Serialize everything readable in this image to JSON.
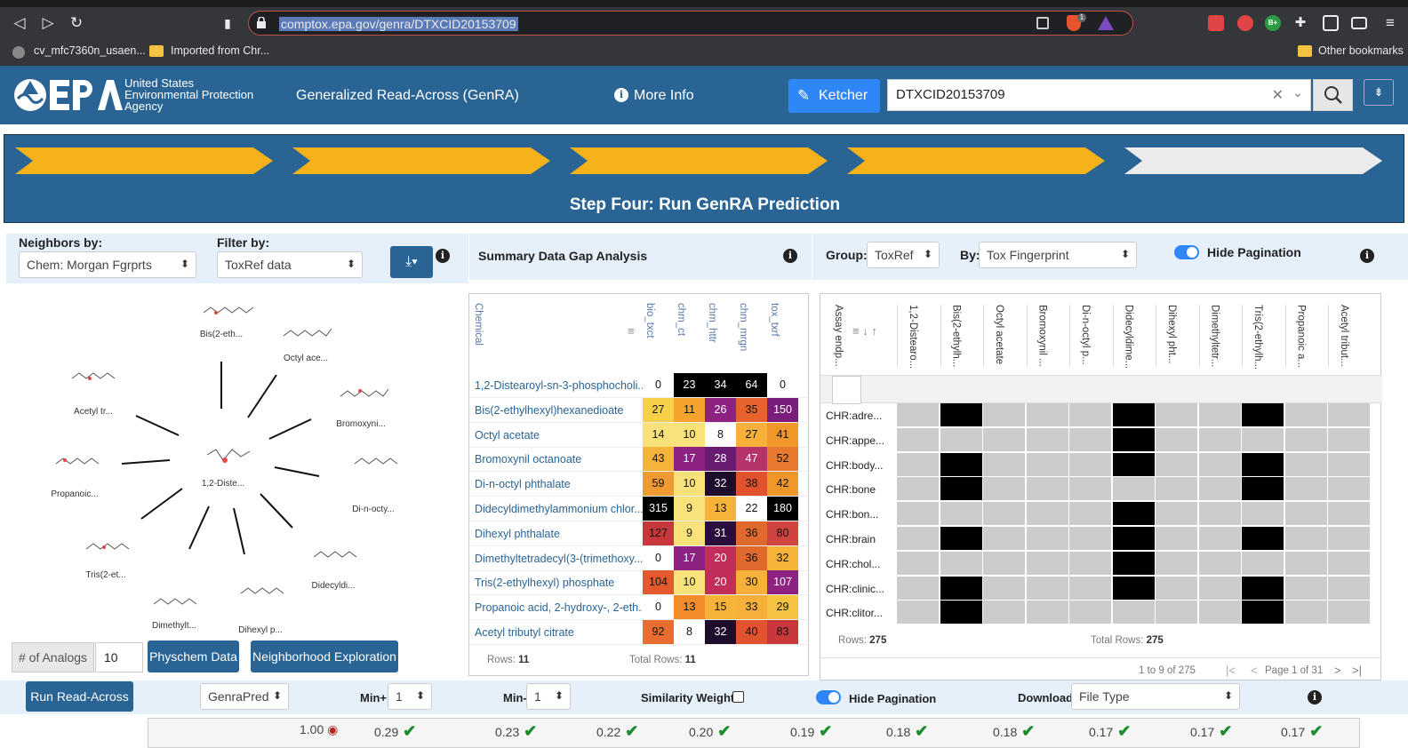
{
  "browser": {
    "url": "comptox.epa.gov/genra/DTXCID20153709",
    "bookmarks": [
      "cv_mfc7360n_usaen...",
      "Imported from Chr..."
    ],
    "other_bookmarks": "Other bookmarks",
    "shield_badge": "1",
    "ext_badge": "B+"
  },
  "header": {
    "agency_line1": "United States",
    "agency_line2": "Environmental Protection",
    "agency_line3": "Agency",
    "app_title": "Generalized Read-Across (GenRA)",
    "more_info": "More Info",
    "ketcher": "Ketcher",
    "search_value": "DTXCID20153709"
  },
  "steps": {
    "title": "Step Four: Run GenRA Prediction",
    "active_color": "#f6b21b",
    "inactive_color": "#ebebeb"
  },
  "left": {
    "neighbors_label": "Neighbors by:",
    "neighbors_value": "Chem: Morgan Fgrprts",
    "filter_label": "Filter by:",
    "filter_value": "ToxRef data",
    "center_node": "1,2-Diste...",
    "nodes": [
      "Bis(2-eth...",
      "Octyl ace...",
      "Bromoxyni...",
      "Di-n-octy...",
      "Didecyldi...",
      "Dihexyl p...",
      "Dimethylt...",
      "Tris(2-et...",
      "Propanoic...",
      "Acetyl tr..."
    ],
    "analogs_label": "# of Analogs",
    "analogs_value": "10",
    "physchem_button": "Physchem Data",
    "neighborhood_button": "Neighborhood Exploration"
  },
  "summary": {
    "title": "Summary Data Gap Analysis",
    "chemical_col": "Chemical",
    "columns": [
      "bio_txct",
      "chm_ct",
      "chm_httr",
      "chm_mrgn",
      "tox_txrf"
    ],
    "rows": [
      {
        "name": "1,2-Distearoyl-sn-3-phosphocholi...",
        "values": [
          "0",
          "23",
          "34",
          "64",
          "0"
        ],
        "colors": [
          "#ffffff",
          "#000000",
          "#000000",
          "#000000",
          "#ffffff"
        ]
      },
      {
        "name": "Bis(2-ethylhexyl)hexanedioate",
        "values": [
          "27",
          "11",
          "26",
          "35",
          "150"
        ],
        "colors": [
          "#f7d04a",
          "#f4a42c",
          "#8e2283",
          "#e8622c",
          "#7a1d7a"
        ]
      },
      {
        "name": "Octyl acetate",
        "values": [
          "14",
          "10",
          "8",
          "27",
          "41"
        ],
        "colors": [
          "#f9e27a",
          "#f9e27a",
          "#ffffff",
          "#f7b13a",
          "#f19629"
        ]
      },
      {
        "name": "Bromoxynil octanoate",
        "values": [
          "43",
          "17",
          "28",
          "47",
          "52"
        ],
        "colors": [
          "#f6b33a",
          "#8e2283",
          "#6a1c72",
          "#b4336a",
          "#e8792e"
        ]
      },
      {
        "name": "Di-n-octyl phthalate",
        "values": [
          "59",
          "10",
          "32",
          "38",
          "42"
        ],
        "colors": [
          "#f09b32",
          "#f9e27a",
          "#1e0c2c",
          "#e0532e",
          "#f19629"
        ]
      },
      {
        "name": "Didecyldimethylammonium chlor...",
        "values": [
          "315",
          "9",
          "13",
          "22",
          "180"
        ],
        "colors": [
          "#000000",
          "#f9e27a",
          "#f6b33a",
          "#ffffff",
          "#000000"
        ]
      },
      {
        "name": "Dihexyl phthalate",
        "values": [
          "127",
          "9",
          "31",
          "36",
          "80"
        ],
        "colors": [
          "#c8383a",
          "#f9e27a",
          "#2a0d3c",
          "#e06a2e",
          "#d0443f"
        ]
      },
      {
        "name": "Dimethyltetradecyl(3-(trimethoxy...",
        "values": [
          "0",
          "17",
          "20",
          "36",
          "32"
        ],
        "colors": [
          "#ffffff",
          "#8e2283",
          "#c22e5a",
          "#e06a2e",
          "#f6b33a"
        ]
      },
      {
        "name": "Tris(2-ethylhexyl) phosphate",
        "values": [
          "104",
          "10",
          "20",
          "30",
          "107"
        ],
        "colors": [
          "#e45a2e",
          "#f9e27a",
          "#c22e5a",
          "#f7b13a",
          "#8e2283"
        ]
      },
      {
        "name": "Propanoic acid, 2-hydroxy-, 2-eth...",
        "values": [
          "0",
          "13",
          "15",
          "33",
          "29"
        ],
        "colors": [
          "#ffffff",
          "#f18b2c",
          "#f6b33a",
          "#f7b13a",
          "#f6c242"
        ]
      },
      {
        "name": "Acetyl tributyl citrate",
        "values": [
          "92",
          "8",
          "32",
          "40",
          "83"
        ],
        "colors": [
          "#e86d2e",
          "#ffffff",
          "#1e0c2c",
          "#e0532e",
          "#c8383a"
        ]
      }
    ],
    "rows_label": "Rows:",
    "rows_count": "11",
    "total_rows_label": "Total Rows:",
    "total_rows_count": "11"
  },
  "fingerprint": {
    "group_label": "Group:",
    "group_value": "ToxRef",
    "by_label": "By:",
    "by_value": "Tox Fingerprint",
    "hide_pagination": "Hide Pagination",
    "assay_col": "Assay endp...",
    "columns": [
      "1,2-Distearo...",
      "Bis(2-ethylh...",
      "Octyl acetate",
      "Bromoxynil ...",
      "Di-n-octyl p...",
      "Didecyldime...",
      "Dihexyl pht...",
      "Dimethyltetr...",
      "Tris(2-ethylh...",
      "Propanoic a...",
      "Acetyl tribut..."
    ],
    "rows": [
      {
        "label": "CHR:adre...",
        "cells": [
          0,
          1,
          0,
          0,
          0,
          1,
          0,
          0,
          1,
          0,
          0
        ]
      },
      {
        "label": "CHR:appe...",
        "cells": [
          0,
          0,
          0,
          0,
          0,
          1,
          0,
          0,
          0,
          0,
          0
        ]
      },
      {
        "label": "CHR:body...",
        "cells": [
          0,
          1,
          0,
          0,
          0,
          1,
          0,
          0,
          1,
          0,
          0
        ]
      },
      {
        "label": "CHR:bone",
        "cells": [
          0,
          1,
          0,
          0,
          0,
          0,
          0,
          0,
          1,
          0,
          0
        ]
      },
      {
        "label": "CHR:bon...",
        "cells": [
          0,
          0,
          0,
          0,
          0,
          1,
          0,
          0,
          0,
          0,
          0
        ]
      },
      {
        "label": "CHR:brain",
        "cells": [
          0,
          1,
          0,
          0,
          0,
          1,
          0,
          0,
          1,
          0,
          0
        ]
      },
      {
        "label": "CHR:chol...",
        "cells": [
          0,
          0,
          0,
          0,
          0,
          1,
          0,
          0,
          0,
          0,
          0
        ]
      },
      {
        "label": "CHR:clinic...",
        "cells": [
          0,
          1,
          0,
          0,
          0,
          1,
          0,
          0,
          1,
          0,
          0
        ]
      },
      {
        "label": "CHR:clitor...",
        "cells": [
          0,
          1,
          0,
          0,
          0,
          0,
          0,
          0,
          1,
          0,
          0
        ]
      }
    ],
    "rows_label": "Rows:",
    "rows_count": "275",
    "total_rows_label": "Total Rows:",
    "total_rows_count": "275",
    "pagination_range": "1 to 9 of 275",
    "page_text": "Page 1 of 31",
    "hit_color": "#000000",
    "miss_color": "#cccccc"
  },
  "bottom": {
    "run_button": "Run Read-Across",
    "genra_select": "GenraPred",
    "min_plus_label": "Min+",
    "min_plus_value": "1",
    "min_minus_label": "Min-",
    "min_minus_value": "1",
    "similarity_label": "Similarity Weight:",
    "hide_pagination": "Hide Pagination",
    "download_label": "Download:",
    "download_value": "File Type",
    "scores": [
      "1.00",
      "0.29",
      "0.23",
      "0.22",
      "0.20",
      "0.19",
      "0.18",
      "0.18",
      "0.17",
      "0.17",
      "0.17"
    ]
  }
}
